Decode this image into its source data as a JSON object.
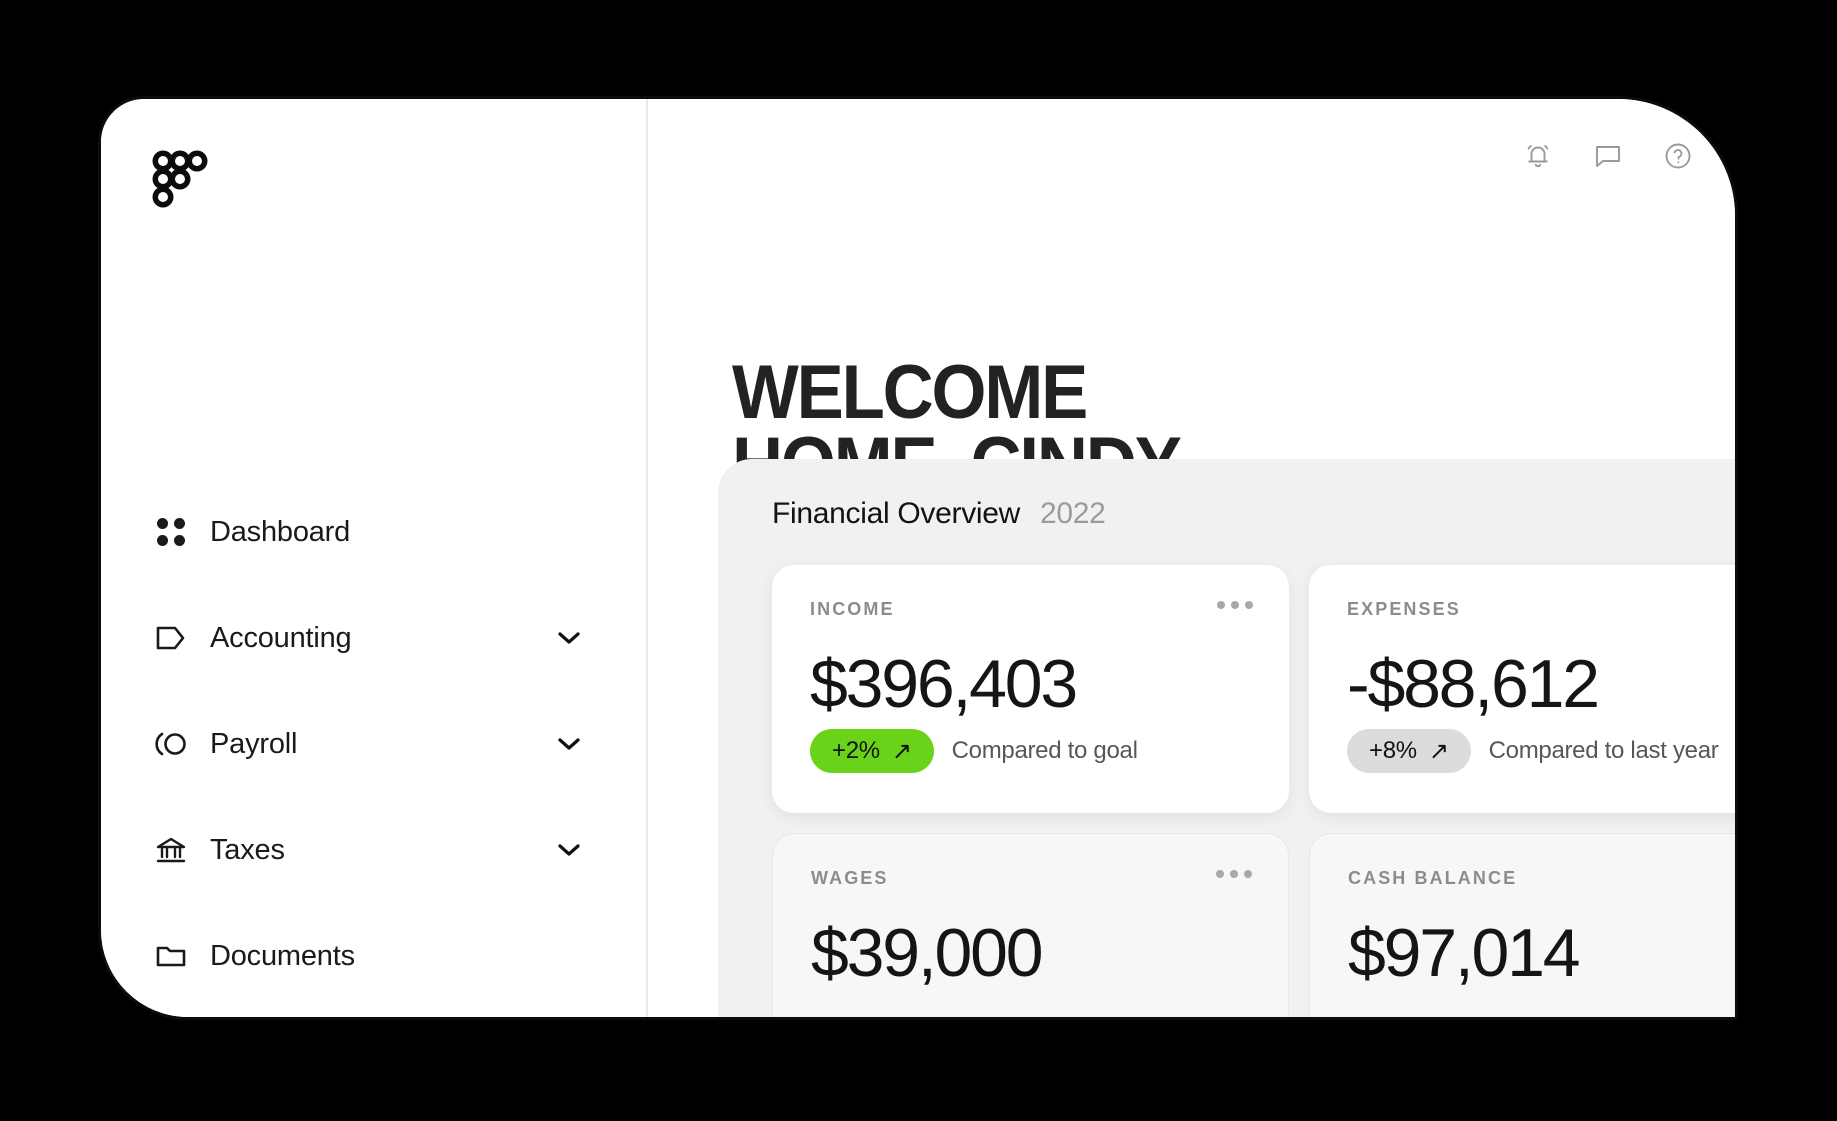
{
  "brand": {
    "logo_icon": "six-circles-logo"
  },
  "topbar": {
    "icons": [
      {
        "name": "notifications-bell-icon",
        "label": "Notifications"
      },
      {
        "name": "messages-chat-icon",
        "label": "Messages"
      },
      {
        "name": "help-question-icon",
        "label": "Help"
      }
    ]
  },
  "sidebar": {
    "items": [
      {
        "label": "Dashboard",
        "icon": "dots-grid-icon",
        "expandable": false
      },
      {
        "label": "Accounting",
        "icon": "tag-icon",
        "expandable": true
      },
      {
        "label": "Payroll",
        "icon": "payroll-circle-icon",
        "expandable": true
      },
      {
        "label": "Taxes",
        "icon": "bank-icon",
        "expandable": true
      },
      {
        "label": "Documents",
        "icon": "folder-icon",
        "expandable": false
      }
    ]
  },
  "header": {
    "title": "WELCOME\nHOME, CINDY"
  },
  "overview": {
    "title": "Financial Overview",
    "year": "2022",
    "menu_icon": "more-horizontal-icon",
    "cards": [
      {
        "label": "INCOME",
        "value": "$396,403",
        "delta": "+2%",
        "delta_arrow": "↗",
        "delta_style": "green",
        "caption": "Compared to goal",
        "has_menu": true,
        "elevated": true
      },
      {
        "label": "EXPENSES",
        "value": "-$88,612",
        "delta": "+8%",
        "delta_arrow": "↗",
        "delta_style": "grey",
        "caption": "Compared to last year",
        "has_menu": false,
        "elevated": true
      },
      {
        "label": "WAGES",
        "value": "$39,000",
        "delta": "",
        "delta_arrow": "",
        "delta_style": "",
        "caption": "",
        "has_menu": true,
        "elevated": false
      },
      {
        "label": "CASH BALANCE",
        "value": "$97,014",
        "delta": "",
        "delta_arrow": "",
        "delta_style": "",
        "caption": "",
        "has_menu": false,
        "elevated": false
      }
    ]
  },
  "colors": {
    "accent_green": "#69d31a",
    "neutral_pill": "#dcdcdc",
    "panel_bg": "#f1f1f1",
    "text_dark": "#151515"
  }
}
